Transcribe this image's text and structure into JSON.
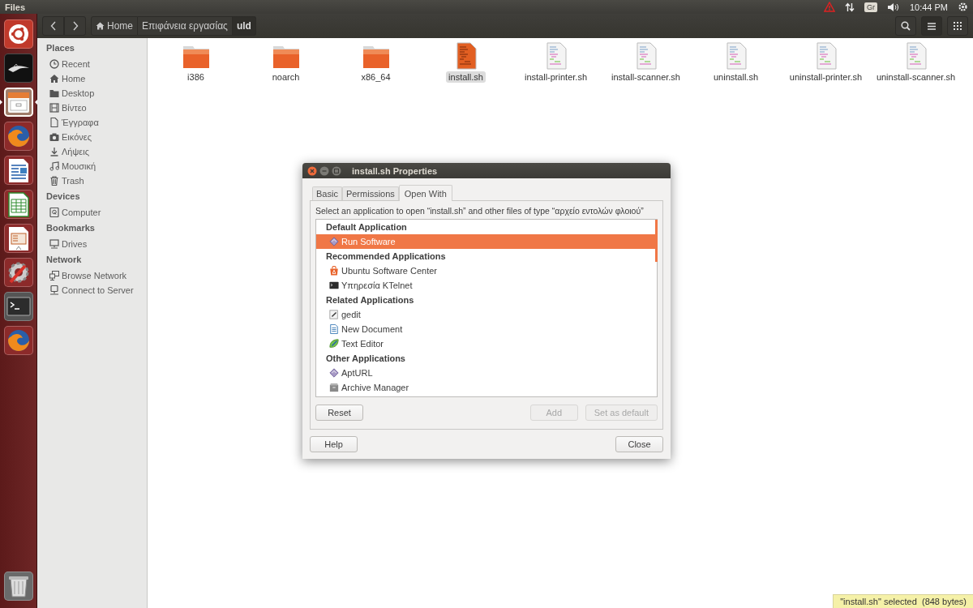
{
  "top_panel": {
    "app_title": "Files",
    "keyboard_layout": "Gr",
    "clock": "10:44 PM"
  },
  "launcher": {
    "items": [
      {
        "kind": "dash",
        "active": false
      },
      {
        "kind": "dragon",
        "active": false
      },
      {
        "kind": "files",
        "active": true
      },
      {
        "kind": "browser",
        "active": false
      },
      {
        "kind": "writer",
        "active": false
      },
      {
        "kind": "calc",
        "active": false
      },
      {
        "kind": "impress",
        "active": false
      },
      {
        "kind": "settings",
        "active": false
      },
      {
        "kind": "terminal",
        "active": false
      },
      {
        "kind": "browser",
        "active": false
      }
    ],
    "trash": {
      "kind": "trash"
    }
  },
  "toolbar": {
    "breadcrumbs": [
      {
        "label": "Home",
        "kind": "home",
        "selected": false
      },
      {
        "label": "Επιφάνεια εργασίας",
        "kind": "plain",
        "selected": false
      },
      {
        "label": "uld",
        "kind": "plain",
        "selected": true
      }
    ]
  },
  "sidebar": {
    "sections": [
      {
        "heading": "Places",
        "items": [
          {
            "label": "Recent",
            "kind": "recent"
          },
          {
            "label": "Home",
            "kind": "home"
          },
          {
            "label": "Desktop",
            "kind": "folder"
          },
          {
            "label": "Βίντεο",
            "kind": "video"
          },
          {
            "label": "Έγγραφα",
            "kind": "document"
          },
          {
            "label": "Εικόνες",
            "kind": "camera"
          },
          {
            "label": "Λήψεις",
            "kind": "download"
          },
          {
            "label": "Μουσική",
            "kind": "music"
          },
          {
            "label": "Trash",
            "kind": "trash"
          }
        ]
      },
      {
        "heading": "Devices",
        "items": [
          {
            "label": "Computer",
            "kind": "drive"
          }
        ]
      },
      {
        "heading": "Bookmarks",
        "items": [
          {
            "label": "Drives",
            "kind": "monitor"
          }
        ]
      },
      {
        "heading": "Network",
        "items": [
          {
            "label": "Browse Network",
            "kind": "network"
          },
          {
            "label": "Connect to Server",
            "kind": "server"
          }
        ]
      }
    ]
  },
  "files": [
    {
      "name": "i386",
      "kind": "folder",
      "selected": false
    },
    {
      "name": "noarch",
      "kind": "folder",
      "selected": false
    },
    {
      "name": "x86_64",
      "kind": "folder",
      "selected": false
    },
    {
      "name": "install.sh",
      "kind": "script",
      "selected": true
    },
    {
      "name": "install-printer.sh",
      "kind": "script",
      "selected": false
    },
    {
      "name": "install-scanner.sh",
      "kind": "script",
      "selected": false
    },
    {
      "name": "uninstall.sh",
      "kind": "script",
      "selected": false
    },
    {
      "name": "uninstall-printer.sh",
      "kind": "script",
      "selected": false
    },
    {
      "name": "uninstall-scanner.sh",
      "kind": "script",
      "selected": false
    }
  ],
  "dialog": {
    "title": "install.sh Properties",
    "tabs": [
      {
        "label": "Basic",
        "selected": false
      },
      {
        "label": "Permissions",
        "selected": false
      },
      {
        "label": "Open With",
        "selected": true
      }
    ],
    "prompt": "Select an application to open “install.sh” and other files of type “αρχείο εντολών φλοιού”",
    "groups": [
      {
        "heading": "Default Application",
        "apps": [
          {
            "name": "Run Software",
            "kind": "diamond",
            "selected": true
          }
        ]
      },
      {
        "heading": "Recommended Applications",
        "apps": [
          {
            "name": "Ubuntu Software Center",
            "kind": "bag",
            "selected": false
          },
          {
            "name": "Υπηρεσία KTelnet",
            "kind": "terminal",
            "selected": false
          }
        ]
      },
      {
        "heading": "Related Applications",
        "apps": [
          {
            "name": "gedit",
            "kind": "editor",
            "selected": false
          },
          {
            "name": "New Document",
            "kind": "document",
            "selected": false
          },
          {
            "name": "Text Editor",
            "kind": "leaf",
            "selected": false
          }
        ]
      },
      {
        "heading": "Other Applications",
        "apps": [
          {
            "name": "AptURL",
            "kind": "diamond",
            "selected": false
          },
          {
            "name": "Archive Manager",
            "kind": "archive",
            "selected": false
          }
        ]
      }
    ],
    "buttons": [
      {
        "label": "Reset",
        "kind": "reset",
        "disabled": false
      },
      {
        "label": "Add",
        "kind": "add",
        "disabled": true
      },
      {
        "label": "Set as default",
        "kind": "set-default",
        "disabled": true
      },
      {
        "label": "Help",
        "kind": "help",
        "disabled": false
      },
      {
        "label": "Close",
        "kind": "close",
        "disabled": false
      }
    ]
  },
  "status": "\"install.sh\" selected  (848 bytes)"
}
